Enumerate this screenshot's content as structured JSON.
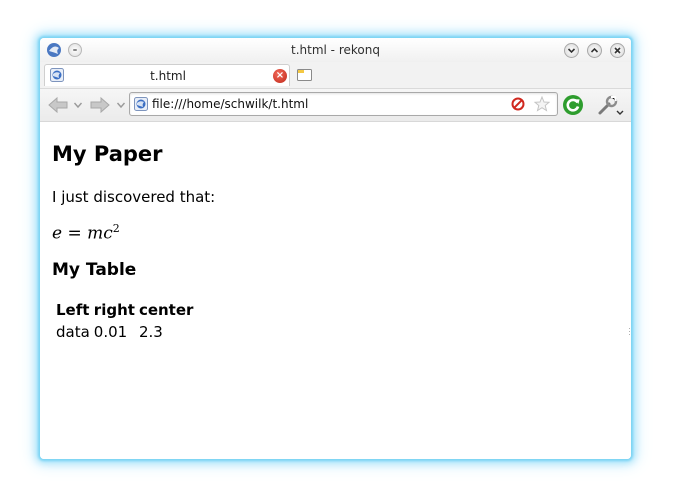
{
  "window": {
    "title": "t.html - rekonq"
  },
  "tabs": [
    {
      "label": "t.html"
    }
  ],
  "navbar": {
    "url": "file:///home/schwilk/t.html"
  },
  "page": {
    "heading": "My Paper",
    "paragraph": "I just discovered that:",
    "equation": {
      "lhs": "e",
      "operator": "=",
      "rhs": "mc",
      "exponent": "2"
    },
    "subheading": "My Table",
    "table": {
      "headers": [
        "Left",
        "right",
        "center"
      ],
      "rows": [
        [
          "data",
          "0.01",
          "2.3"
        ]
      ]
    }
  },
  "colors": {
    "window_glow": "#7cd4f4",
    "reload_green": "#2e9d2e",
    "tab_close_red": "#d6382a"
  }
}
